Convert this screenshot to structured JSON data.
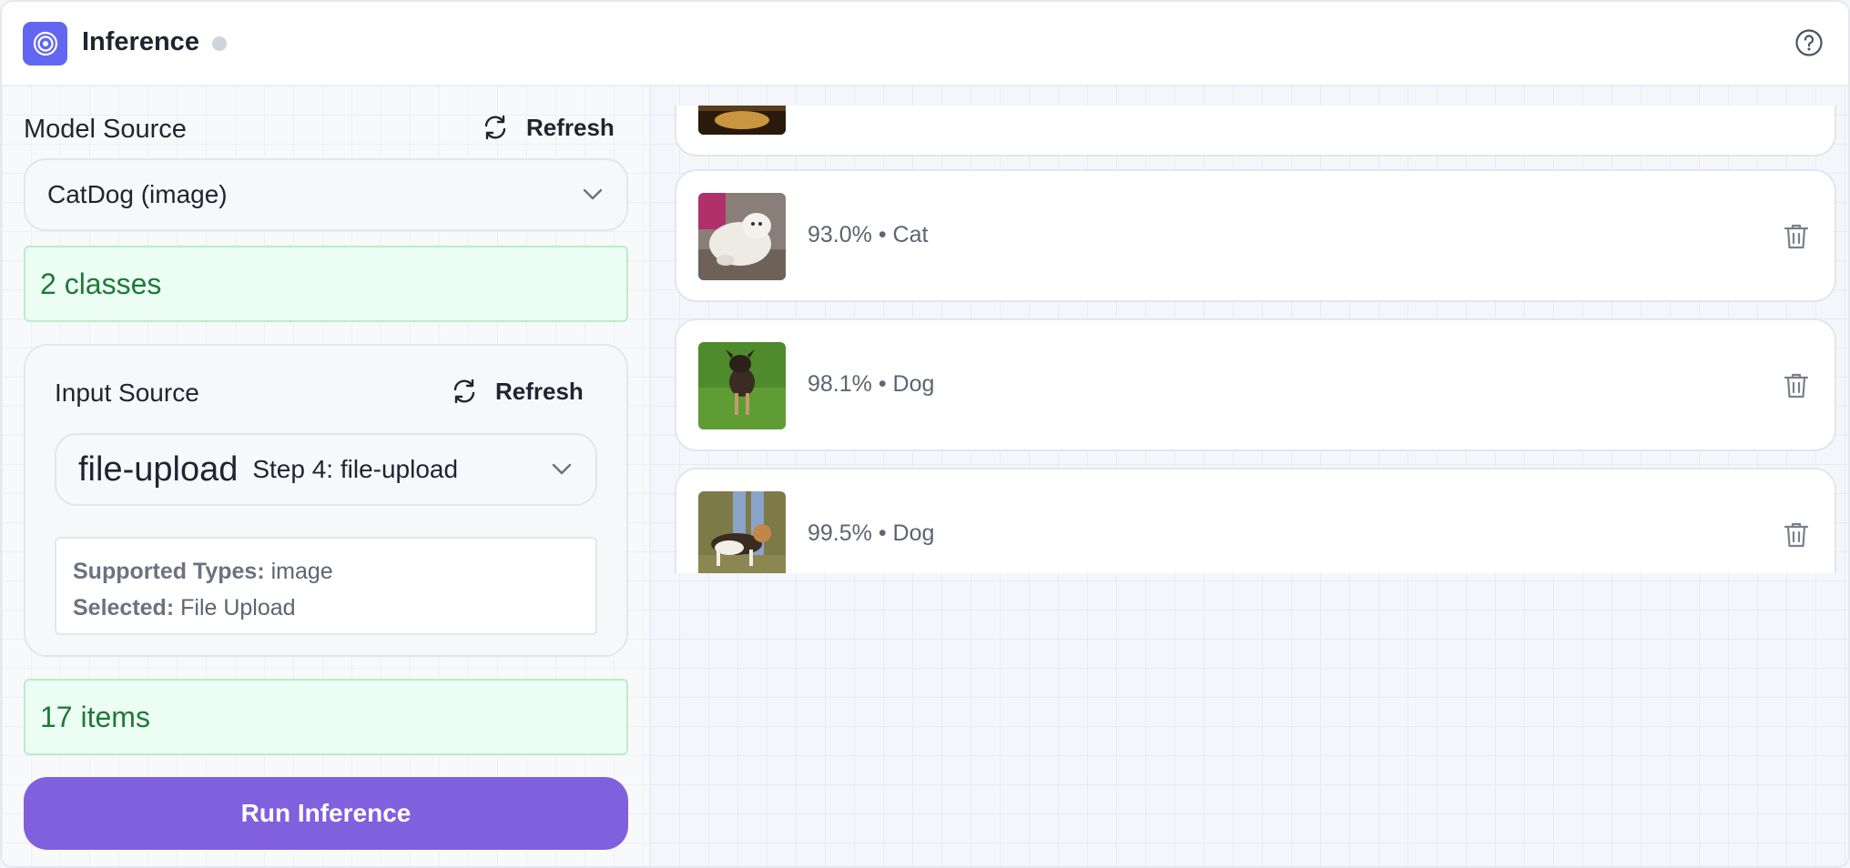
{
  "header": {
    "title": "Inference",
    "app_icon": "target-icon",
    "help_icon": "help-circle-icon"
  },
  "model_source": {
    "label": "Model Source",
    "refresh_label": "Refresh",
    "selected": "CatDog (image)",
    "classes_badge": "2 classes"
  },
  "input_source": {
    "label": "Input Source",
    "refresh_label": "Refresh",
    "selected_name": "file-upload",
    "selected_step": "Step 4: file-upload",
    "supported_types_label": "Supported Types:",
    "supported_types_value": "image",
    "selected_label": "Selected:",
    "selected_value": "File Upload"
  },
  "items_badge": "17 items",
  "run_button": "Run Inference",
  "results": [
    {
      "confidence": "93.0%",
      "label": "Cat",
      "thumb": "cat-photo"
    },
    {
      "confidence": "98.1%",
      "label": "Dog",
      "thumb": "dog-on-grass-photo"
    },
    {
      "confidence": "99.5%",
      "label": "Dog",
      "thumb": "beagle-photo"
    }
  ],
  "colors": {
    "accent": "#8060dc",
    "app_icon": "#6366f1",
    "success_bg": "#ecfdf3",
    "success_text": "#1f7a3a"
  }
}
